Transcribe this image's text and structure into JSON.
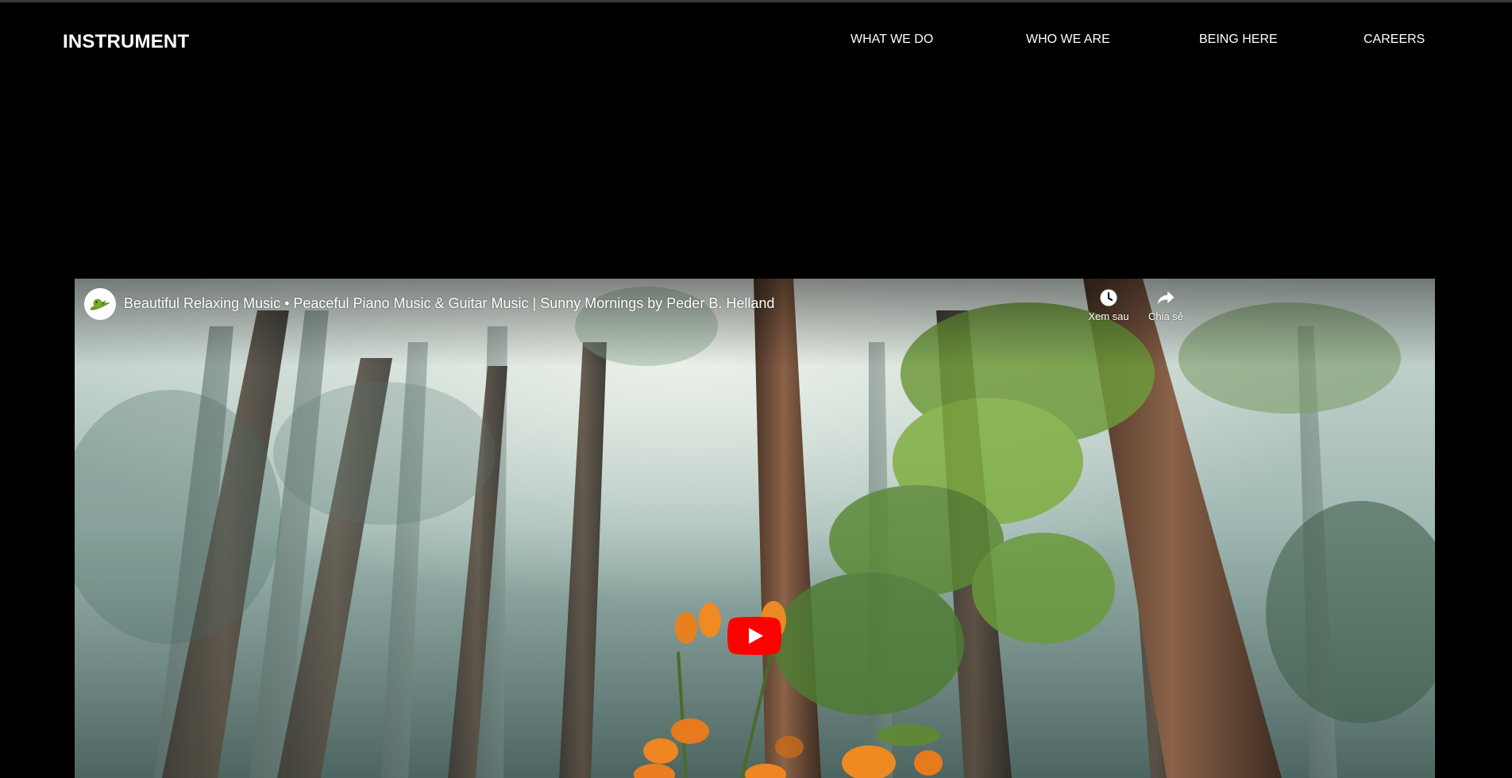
{
  "header": {
    "logo": "INSTRUMENT",
    "nav": [
      {
        "label": "WHAT WE DO"
      },
      {
        "label": "WHO WE ARE"
      },
      {
        "label": "BEING HERE"
      },
      {
        "label": "CAREERS"
      }
    ]
  },
  "video": {
    "title": "Beautiful Relaxing Music • Peaceful Piano Music & Guitar Music | Sunny Mornings by Peder B. Helland",
    "actions": {
      "watch_later": {
        "label": "Xem sau",
        "icon": "clock-icon"
      },
      "share": {
        "label": "Chia sẻ",
        "icon": "share-icon"
      }
    },
    "play_icon": "youtube-play-icon",
    "accent": "#ff0000"
  }
}
